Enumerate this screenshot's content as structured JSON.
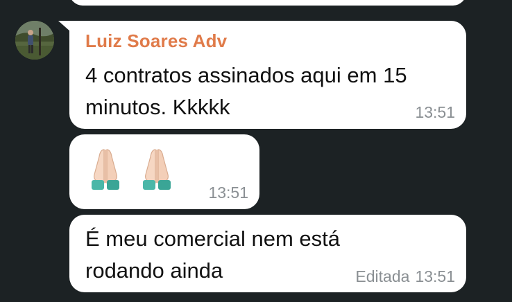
{
  "message_1": {
    "sender": "Luiz Soares Adv",
    "text": "4 contratos assinados aqui em 15\nminutos. Kkkkk",
    "time": "13:51"
  },
  "message_2": {
    "emojis": [
      "folded-hands-icon",
      "folded-hands-icon"
    ],
    "time": "13:51"
  },
  "message_3": {
    "text": "É meu comercial nem está\nrodando ainda",
    "edited_label": "Editada",
    "time": "13:51"
  },
  "colors": {
    "background": "#1c2224",
    "bubble": "#ffffff",
    "sender_name": "#e07b4a",
    "timestamp": "#8a8f93"
  }
}
